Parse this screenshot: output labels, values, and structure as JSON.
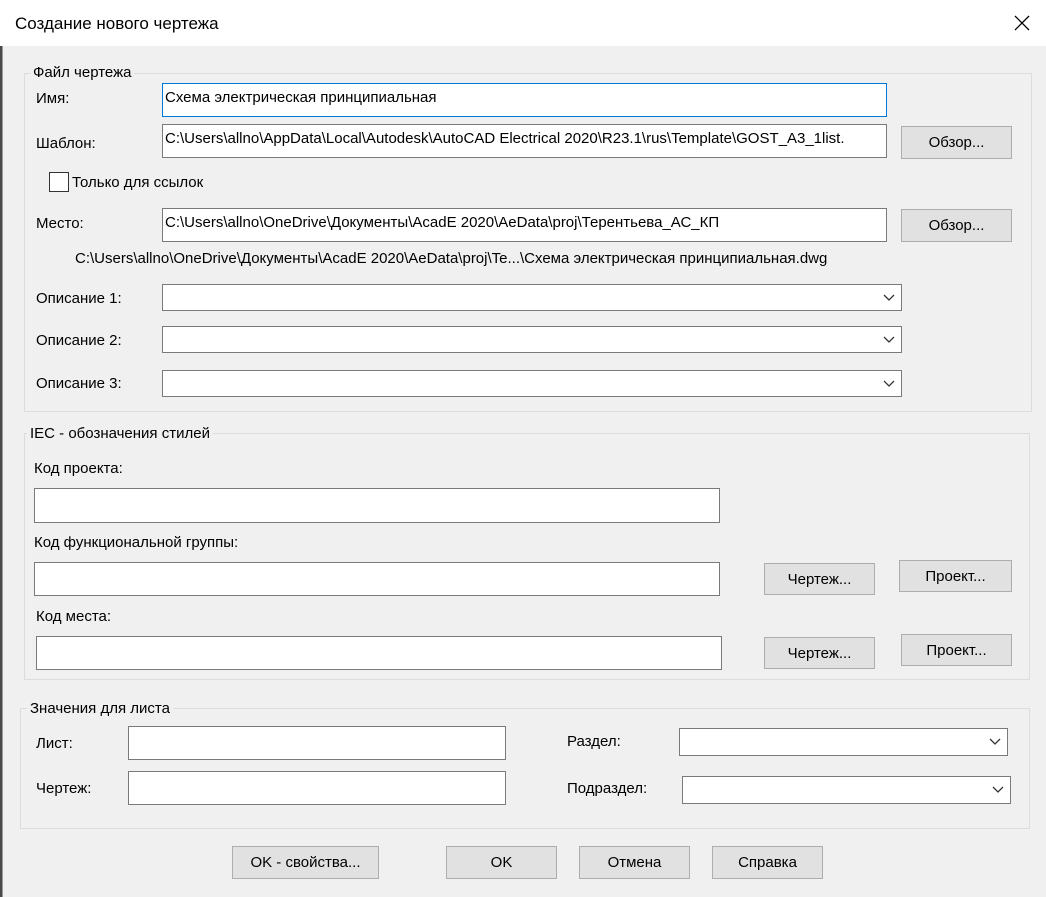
{
  "window": {
    "title": "Создание нового чертежа"
  },
  "icons": {
    "close": "close-icon",
    "chevron": "chevron-down-icon"
  },
  "drawing_file": {
    "group_label": "Файл чертежа",
    "name_label": "Имя:",
    "name_value": "Схема электрическая принципиальная",
    "template_label": "Шаблон:",
    "template_value": "C:\\Users\\allno\\AppData\\Local\\Autodesk\\AutoCAD Electrical 2020\\R23.1\\rus\\Template\\GOST_A3_1list.",
    "browse_label": "Обзор...",
    "reference_only_label": "Только для ссылок",
    "reference_only_checked": false,
    "location_label": "Место:",
    "location_value": "C:\\Users\\allno\\OneDrive\\Документы\\AcadE 2020\\AeData\\proj\\Терентьева_АС_КП",
    "full_path": "C:\\Users\\allno\\OneDrive\\Документы\\AcadE 2020\\AeData\\proj\\Te...\\Схема электрическая принципиальная.dwg",
    "desc1_label": "Описание 1:",
    "desc1_value": "",
    "desc2_label": "Описание 2:",
    "desc2_value": "",
    "desc3_label": "Описание 3:",
    "desc3_value": ""
  },
  "iec": {
    "group_label": "IEC - обозначения стилей",
    "project_code_label": "Код проекта:",
    "project_code_value": "",
    "function_code_label": "Код функциональной группы:",
    "function_code_value": "",
    "location_code_label": "Код места:",
    "location_code_value": "",
    "drawing_btn": "Чертеж...",
    "project_btn": "Проект..."
  },
  "sheet": {
    "group_label": "Значения для листа",
    "sheet_label": "Лист:",
    "sheet_value": "",
    "drawing_label": "Чертеж:",
    "drawing_value": "",
    "section_label": "Раздел:",
    "section_value": "",
    "subsection_label": "Подраздел:",
    "subsection_value": ""
  },
  "footer": {
    "ok_properties": "OK - свойства...",
    "ok": "OK",
    "cancel": "Отмена",
    "help": "Справка"
  }
}
